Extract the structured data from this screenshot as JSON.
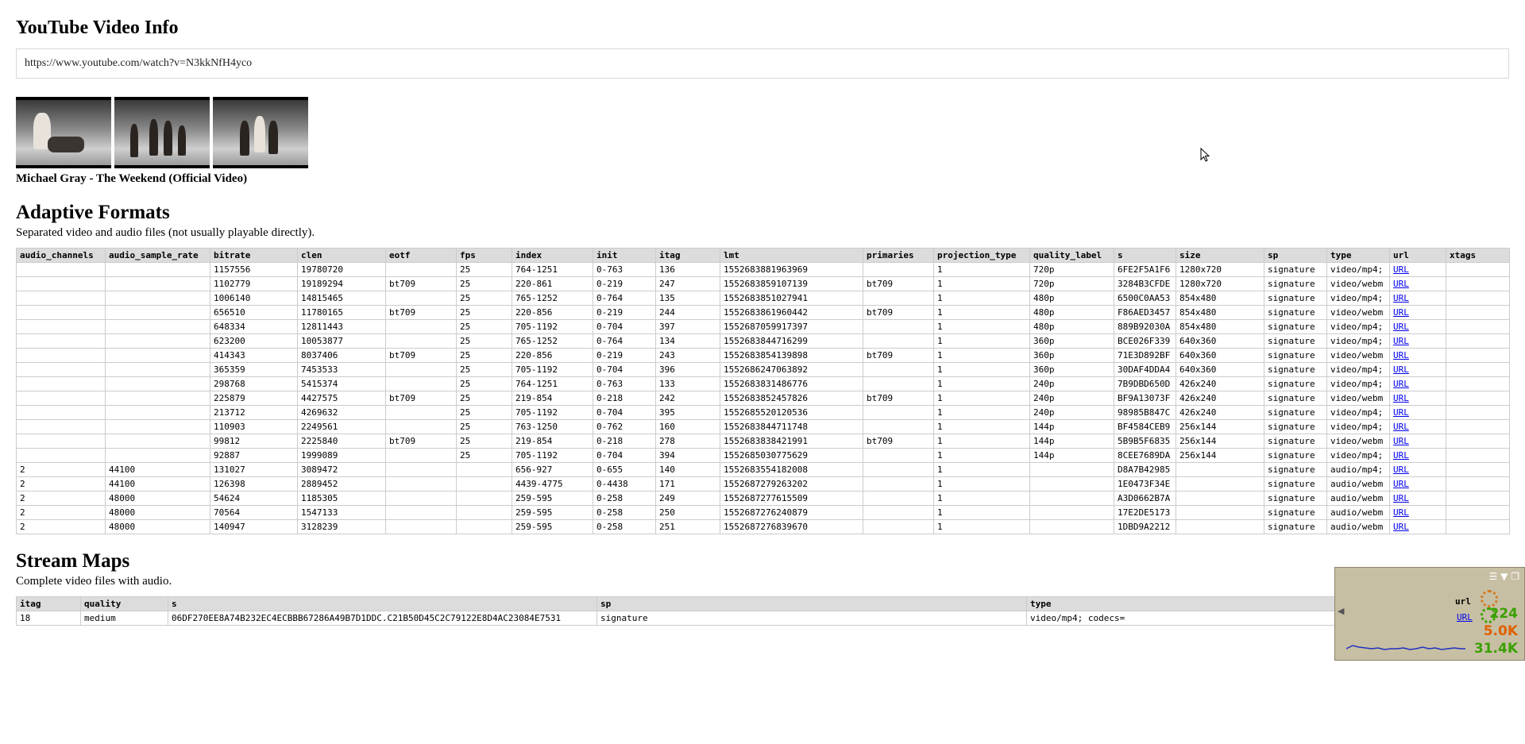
{
  "page": {
    "title": "YouTube Video Info",
    "url_value": "https://www.youtube.com/watch?v=N3kkNfH4yco",
    "video_title": "Michael Gray - The Weekend (Official Video)"
  },
  "adaptive": {
    "heading": "Adaptive Formats",
    "description": "Separated video and audio files (not usually playable directly).",
    "columns": [
      "audio_channels",
      "audio_sample_rate",
      "bitrate",
      "clen",
      "eotf",
      "fps",
      "index",
      "init",
      "itag",
      "lmt",
      "primaries",
      "projection_type",
      "quality_label",
      "s",
      "size",
      "sp",
      "type",
      "url",
      "xtags"
    ],
    "rows": [
      [
        "",
        "",
        "1157556",
        "19780720",
        "",
        "25",
        "764-1251",
        "0-763",
        "136",
        "1552683881963969",
        "",
        "1",
        "720p",
        "6FE2F5A1F6",
        "1280x720",
        "signature",
        "video/mp4;",
        "URL",
        ""
      ],
      [
        "",
        "",
        "1102779",
        "19189294",
        "bt709",
        "25",
        "220-861",
        "0-219",
        "247",
        "1552683859107139",
        "bt709",
        "1",
        "720p",
        "3284B3CFDE",
        "1280x720",
        "signature",
        "video/webm",
        "URL",
        ""
      ],
      [
        "",
        "",
        "1006140",
        "14815465",
        "",
        "25",
        "765-1252",
        "0-764",
        "135",
        "1552683851027941",
        "",
        "1",
        "480p",
        "6500C0AA53",
        "854x480",
        "signature",
        "video/mp4;",
        "URL",
        ""
      ],
      [
        "",
        "",
        "656510",
        "11780165",
        "bt709",
        "25",
        "220-856",
        "0-219",
        "244",
        "1552683861960442",
        "bt709",
        "1",
        "480p",
        "F86AED3457",
        "854x480",
        "signature",
        "video/webm",
        "URL",
        ""
      ],
      [
        "",
        "",
        "648334",
        "12811443",
        "",
        "25",
        "705-1192",
        "0-704",
        "397",
        "1552687059917397",
        "",
        "1",
        "480p",
        "889B92030A",
        "854x480",
        "signature",
        "video/mp4;",
        "URL",
        ""
      ],
      [
        "",
        "",
        "623200",
        "10053877",
        "",
        "25",
        "765-1252",
        "0-764",
        "134",
        "1552683844716299",
        "",
        "1",
        "360p",
        "BCE026F339",
        "640x360",
        "signature",
        "video/mp4;",
        "URL",
        ""
      ],
      [
        "",
        "",
        "414343",
        "8037406",
        "bt709",
        "25",
        "220-856",
        "0-219",
        "243",
        "1552683854139898",
        "bt709",
        "1",
        "360p",
        "71E3D892BF",
        "640x360",
        "signature",
        "video/webm",
        "URL",
        ""
      ],
      [
        "",
        "",
        "365359",
        "7453533",
        "",
        "25",
        "705-1192",
        "0-704",
        "396",
        "1552686247063892",
        "",
        "1",
        "360p",
        "30DAF4DDA4",
        "640x360",
        "signature",
        "video/mp4;",
        "URL",
        ""
      ],
      [
        "",
        "",
        "298768",
        "5415374",
        "",
        "25",
        "764-1251",
        "0-763",
        "133",
        "1552683831486776",
        "",
        "1",
        "240p",
        "7B9DBD650D",
        "426x240",
        "signature",
        "video/mp4;",
        "URL",
        ""
      ],
      [
        "",
        "",
        "225879",
        "4427575",
        "bt709",
        "25",
        "219-854",
        "0-218",
        "242",
        "1552683852457826",
        "bt709",
        "1",
        "240p",
        "BF9A13073F",
        "426x240",
        "signature",
        "video/webm",
        "URL",
        ""
      ],
      [
        "",
        "",
        "213712",
        "4269632",
        "",
        "25",
        "705-1192",
        "0-704",
        "395",
        "1552685520120536",
        "",
        "1",
        "240p",
        "98985B847C",
        "426x240",
        "signature",
        "video/mp4;",
        "URL",
        ""
      ],
      [
        "",
        "",
        "110903",
        "2249561",
        "",
        "25",
        "763-1250",
        "0-762",
        "160",
        "1552683844711748",
        "",
        "1",
        "144p",
        "BF4584CEB9",
        "256x144",
        "signature",
        "video/mp4;",
        "URL",
        ""
      ],
      [
        "",
        "",
        "99812",
        "2225840",
        "bt709",
        "25",
        "219-854",
        "0-218",
        "278",
        "1552683838421991",
        "bt709",
        "1",
        "144p",
        "5B9B5F6835",
        "256x144",
        "signature",
        "video/webm",
        "URL",
        ""
      ],
      [
        "",
        "",
        "92887",
        "1999089",
        "",
        "25",
        "705-1192",
        "0-704",
        "394",
        "1552685030775629",
        "",
        "1",
        "144p",
        "8CEE7689DA",
        "256x144",
        "signature",
        "video/mp4;",
        "URL",
        ""
      ],
      [
        "2",
        "44100",
        "131027",
        "3089472",
        "",
        "",
        "656-927",
        "0-655",
        "140",
        "1552683554182008",
        "",
        "1",
        "",
        "D8A7B42985",
        "",
        "signature",
        "audio/mp4;",
        "URL",
        ""
      ],
      [
        "2",
        "44100",
        "126398",
        "2889452",
        "",
        "",
        "4439-4775",
        "0-4438",
        "171",
        "1552687279263202",
        "",
        "1",
        "",
        "1E0473F34E",
        "",
        "signature",
        "audio/webm",
        "URL",
        ""
      ],
      [
        "2",
        "48000",
        "54624",
        "1185305",
        "",
        "",
        "259-595",
        "0-258",
        "249",
        "1552687277615509",
        "",
        "1",
        "",
        "A3D0662B7A",
        "",
        "signature",
        "audio/webm",
        "URL",
        ""
      ],
      [
        "2",
        "48000",
        "70564",
        "1547133",
        "",
        "",
        "259-595",
        "0-258",
        "250",
        "1552687276240879",
        "",
        "1",
        "",
        "17E2DE5173",
        "",
        "signature",
        "audio/webm",
        "URL",
        ""
      ],
      [
        "2",
        "48000",
        "140947",
        "3128239",
        "",
        "",
        "259-595",
        "0-258",
        "251",
        "1552687276839670",
        "",
        "1",
        "",
        "1DBD9A2212",
        "",
        "signature",
        "audio/webm",
        "URL",
        ""
      ]
    ]
  },
  "streams": {
    "heading": "Stream Maps",
    "description": "Complete video files with audio.",
    "columns": [
      "itag",
      "quality",
      "s",
      "sp",
      "type",
      "url"
    ],
    "rows": [
      [
        "18",
        "medium",
        "06DF270EE8A74B232EC4ECBBB67286A49B7D1DDC.C21B50D45C2C79122E8D4AC23084E7531",
        "signature",
        "video/mp4; codecs=",
        "URL"
      ]
    ]
  },
  "widget": {
    "value1": "224",
    "value2": "5.0K",
    "value3": "31.4K",
    "url_header": "url",
    "url_link": "URL"
  }
}
